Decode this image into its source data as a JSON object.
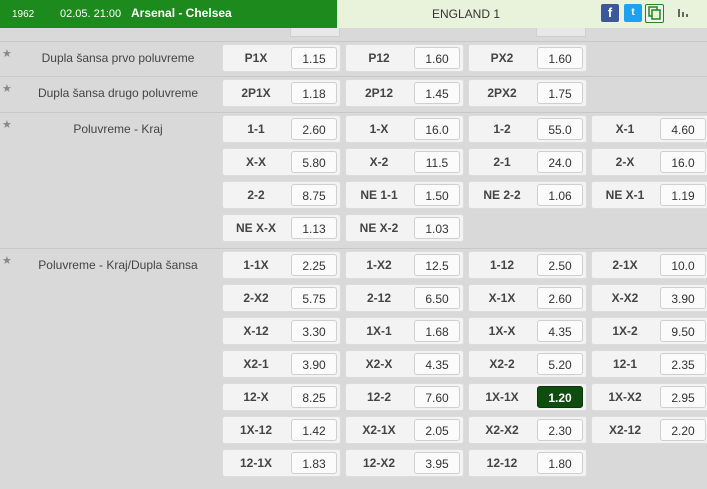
{
  "header": {
    "event_id": "1962",
    "datetime": "02.05. 21:00",
    "match": "Arsenal - Chelsea",
    "league": "ENGLAND 1",
    "share_facebook": "f",
    "share_twitter": "t"
  },
  "colors": {
    "accent": "#1c8a1c",
    "selected_odd": "#0e4d0e"
  },
  "markets": [
    {
      "name": "Dupla šansa prvo poluvreme",
      "rows": [
        [
          {
            "label": "P1X",
            "odd": "1.15"
          },
          {
            "label": "P12",
            "odd": "1.60"
          },
          {
            "label": "PX2",
            "odd": "1.60"
          }
        ]
      ]
    },
    {
      "name": "Dupla šansa drugo poluvreme",
      "rows": [
        [
          {
            "label": "2P1X",
            "odd": "1.18"
          },
          {
            "label": "2P12",
            "odd": "1.45"
          },
          {
            "label": "2PX2",
            "odd": "1.75"
          }
        ]
      ]
    },
    {
      "name": "Poluvreme - Kraj",
      "rows": [
        [
          {
            "label": "1-1",
            "odd": "2.60"
          },
          {
            "label": "1-X",
            "odd": "16.0"
          },
          {
            "label": "1-2",
            "odd": "55.0"
          },
          {
            "label": "X-1",
            "odd": "4.60"
          }
        ],
        [
          {
            "label": "X-X",
            "odd": "5.80"
          },
          {
            "label": "X-2",
            "odd": "11.5"
          },
          {
            "label": "2-1",
            "odd": "24.0"
          },
          {
            "label": "2-X",
            "odd": "16.0"
          }
        ],
        [
          {
            "label": "2-2",
            "odd": "8.75"
          },
          {
            "label": "NE 1-1",
            "odd": "1.50"
          },
          {
            "label": "NE 2-2",
            "odd": "1.06"
          },
          {
            "label": "NE X-1",
            "odd": "1.19"
          }
        ],
        [
          {
            "label": "NE X-X",
            "odd": "1.13"
          },
          {
            "label": "NE X-2",
            "odd": "1.03"
          }
        ]
      ]
    },
    {
      "name": "Poluvreme - Kraj/Dupla šansa",
      "rows": [
        [
          {
            "label": "1-1X",
            "odd": "2.25"
          },
          {
            "label": "1-X2",
            "odd": "12.5"
          },
          {
            "label": "1-12",
            "odd": "2.50"
          },
          {
            "label": "2-1X",
            "odd": "10.0"
          }
        ],
        [
          {
            "label": "2-X2",
            "odd": "5.75"
          },
          {
            "label": "2-12",
            "odd": "6.50"
          },
          {
            "label": "X-1X",
            "odd": "2.60"
          },
          {
            "label": "X-X2",
            "odd": "3.90"
          }
        ],
        [
          {
            "label": "X-12",
            "odd": "3.30"
          },
          {
            "label": "1X-1",
            "odd": "1.68"
          },
          {
            "label": "1X-X",
            "odd": "4.35"
          },
          {
            "label": "1X-2",
            "odd": "9.50"
          }
        ],
        [
          {
            "label": "X2-1",
            "odd": "3.90"
          },
          {
            "label": "X2-X",
            "odd": "4.35"
          },
          {
            "label": "X2-2",
            "odd": "5.20"
          },
          {
            "label": "12-1",
            "odd": "2.35"
          }
        ],
        [
          {
            "label": "12-X",
            "odd": "8.25"
          },
          {
            "label": "12-2",
            "odd": "7.60"
          },
          {
            "label": "1X-1X",
            "odd": "1.20",
            "selected": true
          },
          {
            "label": "1X-X2",
            "odd": "2.95"
          }
        ],
        [
          {
            "label": "1X-12",
            "odd": "1.42"
          },
          {
            "label": "X2-1X",
            "odd": "2.05"
          },
          {
            "label": "X2-X2",
            "odd": "2.30"
          },
          {
            "label": "X2-12",
            "odd": "2.20"
          }
        ],
        [
          {
            "label": "12-1X",
            "odd": "1.83"
          },
          {
            "label": "12-X2",
            "odd": "3.95"
          },
          {
            "label": "12-12",
            "odd": "1.80"
          }
        ]
      ]
    }
  ]
}
